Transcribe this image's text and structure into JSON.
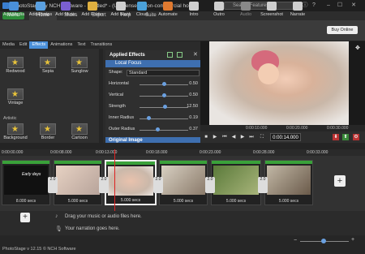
{
  "window": {
    "title": "PhotoStage by NCH Software - Untitled* - (Unlicensed) Non-commercial ho...",
    "search_placeholder": "Search Features"
  },
  "tabs": [
    "Menu",
    "Home",
    "Slides",
    "Export",
    "Help",
    "Suite"
  ],
  "ribbon": {
    "buttons": [
      {
        "label": "Add Media",
        "color": "#4a8fd8"
      },
      {
        "label": "Add Photos",
        "color": "#5aa0e0"
      },
      {
        "label": "Add Music",
        "color": "#7a5fd0"
      },
      {
        "label": "Add Folder",
        "color": "#e0b040"
      },
      {
        "label": "Add Blank",
        "color": "#cfcfcf"
      },
      {
        "label": "Cloud",
        "color": "#4aa0d8"
      },
      {
        "label": "Automate",
        "color": "#e07a30"
      },
      {
        "label": "Intro",
        "color": "#cfcfcf"
      },
      {
        "label": "Outro",
        "color": "#cfcfcf"
      },
      {
        "label": "Audio",
        "color": "#888888"
      },
      {
        "label": "Screenshot",
        "color": "#cfcfcf"
      },
      {
        "label": "Narrate",
        "color": "#cfcfcf"
      }
    ],
    "buy_label": "Buy Online"
  },
  "left_tabs": [
    "Media",
    "Edit",
    "Effects",
    "Animations",
    "Text",
    "Transitions"
  ],
  "effects": {
    "items": [
      "Redwood",
      "Sepia",
      "Sunglow",
      "Vintage"
    ],
    "section_label": "Artistic",
    "artistic_items": [
      "Background",
      "Border",
      "Cartoon"
    ]
  },
  "applied_effects": {
    "title": "Applied Effects",
    "effect_name": "Local Focus",
    "shape_label": "Shape:",
    "shape_value": "Standard",
    "params": [
      {
        "label": "Horizontal",
        "value": "0.50",
        "level": 0.5
      },
      {
        "label": "Vertical",
        "value": "0.50",
        "level": 0.5
      },
      {
        "label": "Strength",
        "value": "12.50",
        "level": 0.52
      },
      {
        "label": "Inner Radius",
        "value": "0.19",
        "level": 0.19
      },
      {
        "label": "Outer Radius",
        "value": "0.37",
        "level": 0.37
      }
    ],
    "original_label": "Original Image"
  },
  "preview": {
    "ticks": [
      "0:00:10.000",
      "0:00:20.000",
      "0:00:30.000"
    ],
    "timecode": "0:00:14.000"
  },
  "timeline": {
    "ruler": [
      "0:00:00.000",
      "0:00:08.000",
      "0:00:13.000",
      "0:00:18.000",
      "0:00:23.000",
      "0:00:28.000",
      "0:00:33.000"
    ],
    "clips": [
      {
        "duration": "8.000 secs",
        "caption": "Early days"
      },
      {
        "duration": "5.000 secs"
      },
      {
        "duration": "5.000 secs"
      },
      {
        "duration": "5.000 secs"
      },
      {
        "duration": "5.000 secs"
      },
      {
        "duration": "5.000 secs"
      }
    ],
    "transition_duration": "2.0"
  },
  "tracks": {
    "audio_hint": "Drag your music or audio files here.",
    "narration_hint": "Your narration goes here."
  },
  "status": "PhotoStage v 12.15 © NCH Software"
}
